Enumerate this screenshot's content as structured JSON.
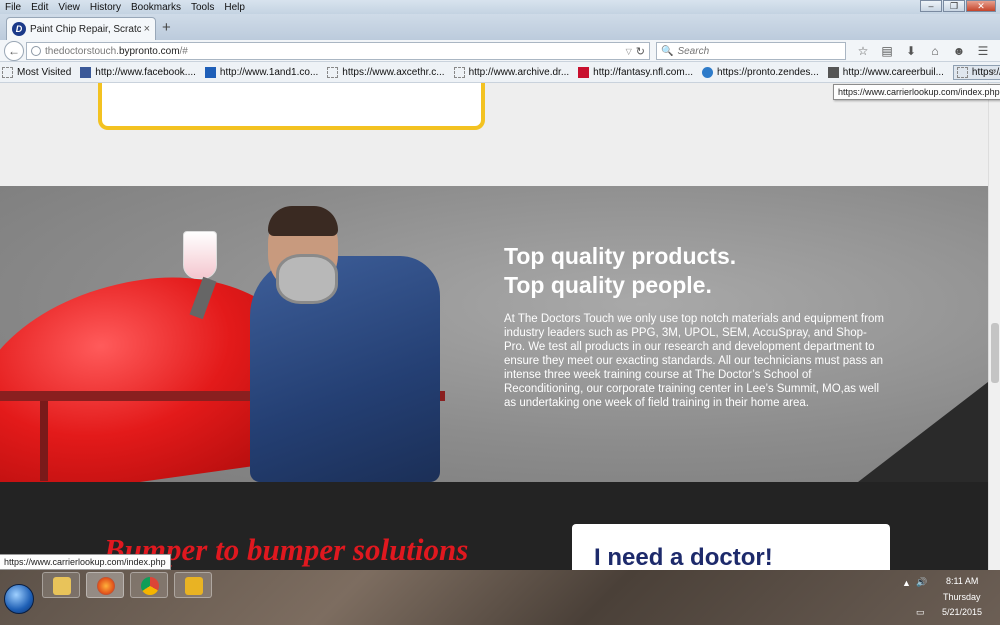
{
  "menu": [
    "File",
    "Edit",
    "View",
    "History",
    "Bookmarks",
    "Tools",
    "Help"
  ],
  "window_controls": {
    "minimize": "–",
    "restore": "❐",
    "close": "✕"
  },
  "tab": {
    "title": "Paint Chip Repair, Scratch ...",
    "favicon_letter": "D",
    "close": "×",
    "new_tab": "+"
  },
  "navbar": {
    "url_domain": "thedoctorstouch.",
    "url_host": "bypronto.com",
    "url_path": "/#",
    "search_placeholder": "Search",
    "icons": [
      "star-icon",
      "reading-list-icon",
      "download-icon",
      "home-icon",
      "chat-icon",
      "menu-icon"
    ]
  },
  "bookmarks": [
    {
      "label": "Most Visited",
      "icon": "gear-icon"
    },
    {
      "label": "http://www.facebook....",
      "icon": "facebook-icon"
    },
    {
      "label": "http://www.1and1.co...",
      "icon": "1and1-icon"
    },
    {
      "label": "https://www.axcethr.c...",
      "icon": "page-icon"
    },
    {
      "label": "http://www.archive.dr...",
      "icon": "page-icon"
    },
    {
      "label": "http://fantasy.nfl.com...",
      "icon": "nfl-icon"
    },
    {
      "label": "https://pronto.zendes...",
      "icon": "zendesk-icon"
    },
    {
      "label": "http://www.careerbuil...",
      "icon": "careerbuilder-icon"
    },
    {
      "label": "https://www.carrierloo...",
      "icon": "page-icon"
    }
  ],
  "tooltip": "https://www.carrierlookup.com/index.php",
  "hero": {
    "heading_line1": "Top quality products.",
    "heading_line2": "Top quality people.",
    "body": "At The Doctors Touch we only use top notch materials and equipment from industry leaders such as PPG, 3M, UPOL, SEM, AccuSpray, and Shop-Pro. We test all products in our research and development department to ensure they meet our exacting standards. All our technicians must pass an intense three week training course at The Doctor’s School of Reconditioning, our corporate training center in Lee’s Summit, MO,as well as undertaking one week of field training in their home area."
  },
  "lower": {
    "heading": "Bumper to bumper solutions",
    "card_heading": "I need a doctor!"
  },
  "status_url": "https://www.carrierlookup.com/index.php",
  "taskbar": {
    "clock_time": "8:11 AM",
    "clock_day": "Thursday",
    "clock_date": "5/21/2015"
  },
  "colors": {
    "accent_yellow": "#f3c221",
    "heading_red": "#e0181f",
    "card_navy": "#1d2a6b",
    "dark_band": "#232323"
  }
}
